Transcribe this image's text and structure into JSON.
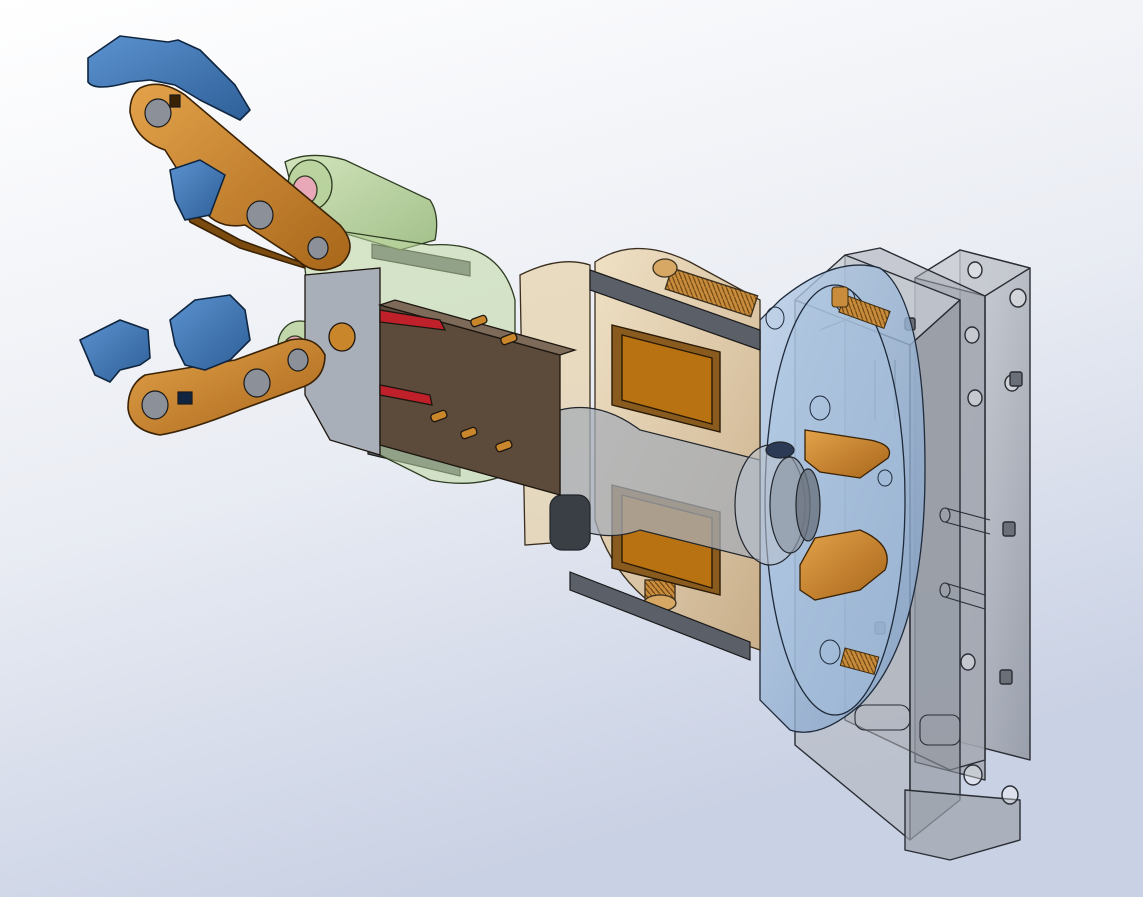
{
  "scene": {
    "description_visible_text": "",
    "colors": {
      "background_top": "#ffffff",
      "background_bottom": "#c9d1e4",
      "finger_blue": "#3f79b9",
      "finger_blue_dark": "#26558c",
      "linkage_orange": "#c9862b",
      "linkage_orange_dark": "#7a4a0f",
      "housing_green": "#a9c98a",
      "pink_spacer": "#e8a8b8",
      "slider_brown": "#5c4a3a",
      "coil_orange": "#b87212",
      "motor_tan": "#d9c3a0",
      "flange_blue": "#9ab7d6",
      "mount_gray": "#a9adb6",
      "rod_dark": "#3c4048",
      "red_wire": "#c0202a",
      "edge": "#1a1a1a"
    },
    "components": [
      {
        "name": "upper-finger",
        "material": "blue"
      },
      {
        "name": "lower-finger",
        "material": "blue"
      },
      {
        "name": "upper-linkage",
        "material": "orange"
      },
      {
        "name": "lower-linkage",
        "material": "orange"
      },
      {
        "name": "gripper-housing",
        "material": "green-translucent"
      },
      {
        "name": "slider-plate",
        "material": "brown"
      },
      {
        "name": "electromagnet-coils",
        "material": "orange"
      },
      {
        "name": "motor-housing",
        "material": "tan-translucent"
      },
      {
        "name": "flange",
        "material": "blue-translucent"
      },
      {
        "name": "mounting-block",
        "material": "gray-translucent"
      }
    ]
  }
}
